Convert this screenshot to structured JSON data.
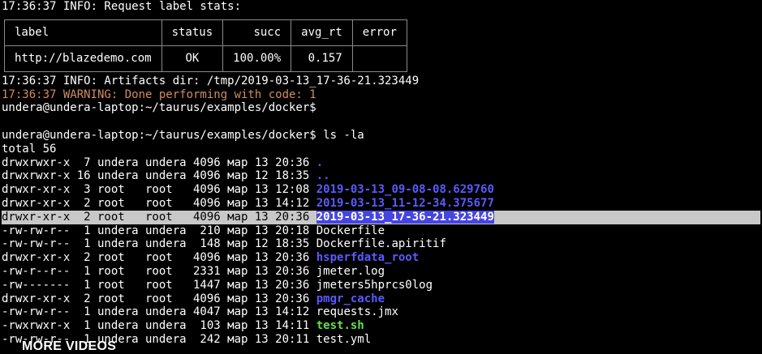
{
  "header_line": "17:36:37 INFO: Request label stats:",
  "stats_table": {
    "headers": [
      "label",
      "status",
      "succ",
      "avg_rt",
      "error"
    ],
    "row": [
      "http://blazedemo.com",
      "OK",
      "100.00%",
      "0.157",
      ""
    ]
  },
  "artifacts_line": "17:36:37 INFO: Artifacts dir: /tmp/2019-03-13_17-36-21.323449",
  "warning_line": "17:36:37 WARNING: Done performing with code: 1",
  "prompt_line": "undera@undera-laptop:~/taurus/examples/docker$",
  "command_line": "undera@undera-laptop:~/taurus/examples/docker$ ls -la",
  "total_line": "total 56",
  "listing": [
    {
      "meta": "drwxrwxr-x  7 undera undera 4096 мар 13 20:36 ",
      "name": ".",
      "kind": "dir"
    },
    {
      "meta": "drwxrwxr-x 16 undera undera 4096 мар 12 18:35 ",
      "name": "..",
      "kind": "dir"
    },
    {
      "meta": "drwxr-xr-x  3 root   root   4096 мар 13 12:08 ",
      "name": "2019-03-13_09-08-08.629760",
      "kind": "dir"
    },
    {
      "meta": "drwxr-xr-x  2 root   root   4096 мар 13 14:12 ",
      "name": "2019-03-13_11-12-34.375677",
      "kind": "dir"
    },
    {
      "meta": "drwxr-xr-x  2 root   root   4096 мар 13 20:36 ",
      "name": "2019-03-13_17-36-21.323449",
      "kind": "selected"
    },
    {
      "meta": "-rw-rw-r--  1 undera undera  210 мар 13 20:18 ",
      "name": "Dockerfile",
      "kind": "file"
    },
    {
      "meta": "-rw-rw-r--  1 undera undera  148 мар 12 18:35 ",
      "name": "Dockerfile.apiritif",
      "kind": "file"
    },
    {
      "meta": "drwxr-xr-x  2 root   root   4096 мар 13 20:36 ",
      "name": "hsperfdata_root",
      "kind": "dir"
    },
    {
      "meta": "-rw-r--r--  1 root   root   2331 мар 13 20:36 ",
      "name": "jmeter.log",
      "kind": "file"
    },
    {
      "meta": "-rw-------  1 root   root   1447 мар 13 20:36 ",
      "name": "jmeters5hprcs0log",
      "kind": "file"
    },
    {
      "meta": "drwxr-xr-x  2 root   root   4096 мар 13 20:36 ",
      "name": "pmgr_cache",
      "kind": "dir"
    },
    {
      "meta": "-rw-rw-r--  1 undera undera 4047 мар 13 14:12 ",
      "name": "requests.jmx",
      "kind": "file"
    },
    {
      "meta": "-rwxrwxr-x  1 undera undera  103 мар 13 14:11 ",
      "name": "test.sh",
      "kind": "exec"
    },
    {
      "meta": "-rw-rw-r--  1 undera undera  242 мар 13 20:11 ",
      "name": "test.yml",
      "kind": "file"
    }
  ],
  "overlay_text": "MORE VIDEOS",
  "colors": {
    "background": "#000000",
    "text": "#ffffff",
    "warning": "#d08c60",
    "directory": "#5a5aff",
    "executable": "#66e04a",
    "selection_row": "#c8c8c8",
    "selection_name": "#4545e0"
  }
}
